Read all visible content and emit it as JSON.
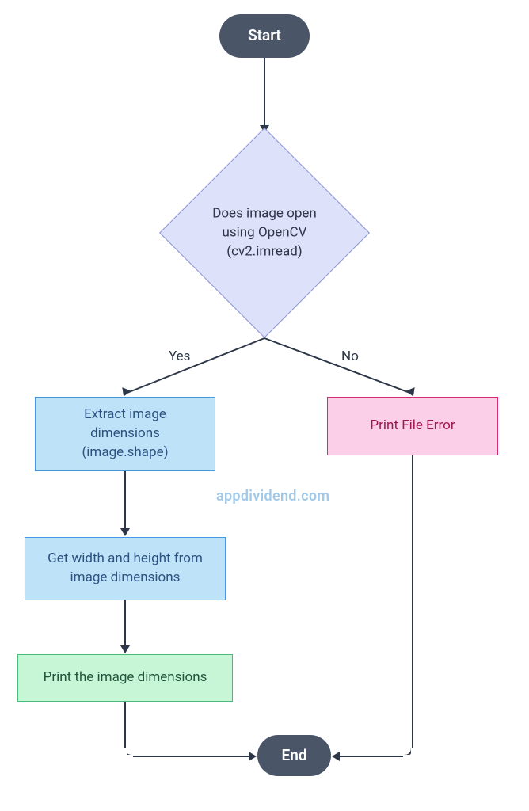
{
  "chart_data": {
    "type": "flowchart",
    "nodes": [
      {
        "id": "start",
        "kind": "terminator",
        "label": "Start"
      },
      {
        "id": "decision",
        "kind": "decision",
        "label": "Does image open using OpenCV (cv2.imread)"
      },
      {
        "id": "extract",
        "kind": "process",
        "label": "Extract image dimensions (image.shape)"
      },
      {
        "id": "getwh",
        "kind": "process",
        "label": "Get width and height from image dimensions"
      },
      {
        "id": "print",
        "kind": "process",
        "label": "Print the image dimensions"
      },
      {
        "id": "error",
        "kind": "process",
        "label": "Print File Error"
      },
      {
        "id": "end",
        "kind": "terminator",
        "label": "End"
      }
    ],
    "edges": [
      {
        "from": "start",
        "to": "decision",
        "label": ""
      },
      {
        "from": "decision",
        "to": "extract",
        "label": "Yes"
      },
      {
        "from": "decision",
        "to": "error",
        "label": "No"
      },
      {
        "from": "extract",
        "to": "getwh",
        "label": ""
      },
      {
        "from": "getwh",
        "to": "print",
        "label": ""
      },
      {
        "from": "print",
        "to": "end",
        "label": ""
      },
      {
        "from": "error",
        "to": "end",
        "label": ""
      }
    ]
  },
  "nodes": {
    "start": "Start",
    "decision_line1": "Does image open",
    "decision_line2": "using OpenCV",
    "decision_line3": "(cv2.imread)",
    "extract_line1": "Extract image",
    "extract_line2": "dimensions",
    "extract_line3": "(image.shape)",
    "getwh_line1": "Get width and height from",
    "getwh_line2": "image dimensions",
    "print": "Print the image dimensions",
    "error": "Print File Error",
    "end": "End"
  },
  "labels": {
    "yes": "Yes",
    "no": "No"
  },
  "watermark": "appdividend.com"
}
